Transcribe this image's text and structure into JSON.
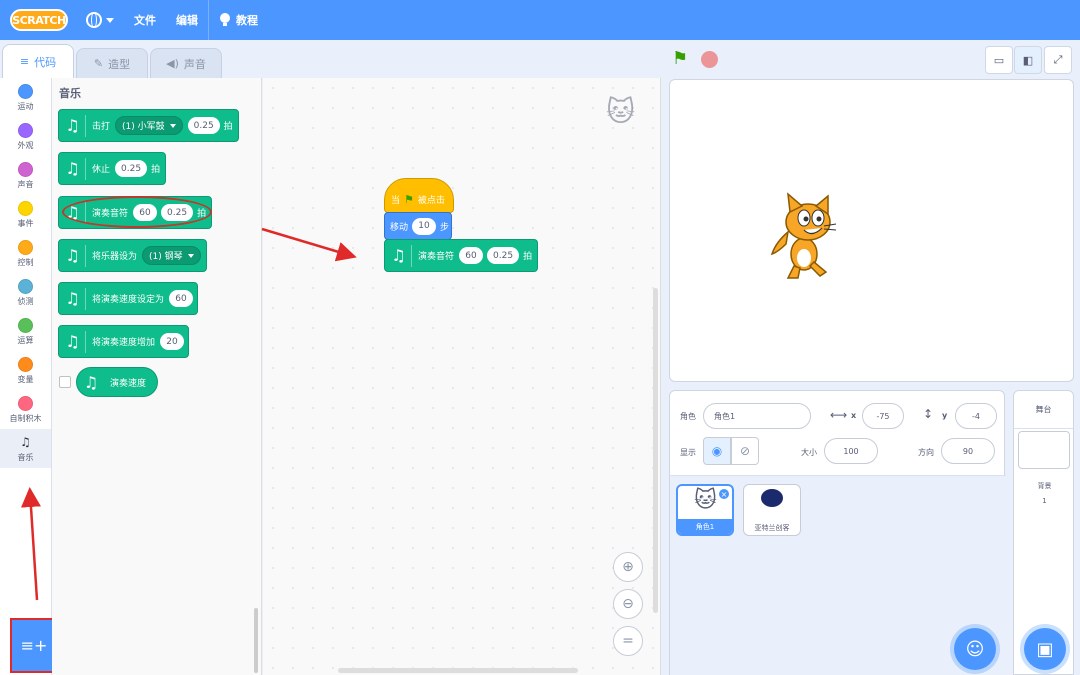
{
  "menubar": {
    "logo": "SCRATCH",
    "file": "文件",
    "edit": "编辑",
    "tutorials": "教程"
  },
  "tabs": [
    {
      "label": "代码",
      "icon": "code-icon",
      "active": true
    },
    {
      "label": "造型",
      "icon": "brush-icon",
      "active": false
    },
    {
      "label": "声音",
      "icon": "speaker-icon",
      "active": false
    }
  ],
  "categories": [
    {
      "label": "运动",
      "color": "#4c97ff"
    },
    {
      "label": "外观",
      "color": "#9966ff"
    },
    {
      "label": "声音",
      "color": "#cf63cf"
    },
    {
      "label": "事件",
      "color": "#ffd500"
    },
    {
      "label": "控制",
      "color": "#ffab19"
    },
    {
      "label": "侦测",
      "color": "#5cb1d6"
    },
    {
      "label": "运算",
      "color": "#59c059"
    },
    {
      "label": "变量",
      "color": "#ff8c1a"
    },
    {
      "label": "自制积木",
      "color": "#ff6680"
    },
    {
      "label": "音乐",
      "color": "#0fbd8c"
    }
  ],
  "palette": {
    "title": "音乐",
    "blocks": {
      "drum": {
        "text": "击打",
        "dropdown": "(1) 小军鼓",
        "beats": "0.25",
        "unit": "拍"
      },
      "rest": {
        "text": "休止",
        "beats": "0.25",
        "unit": "拍"
      },
      "note": {
        "text": "演奏音符",
        "note": "60",
        "beats": "0.25",
        "unit": "拍"
      },
      "instrument": {
        "text": "将乐器设为",
        "dropdown": "(1) 钢琴"
      },
      "tempo_set": {
        "text": "将演奏速度设定为",
        "value": "60"
      },
      "tempo_change": {
        "text": "将演奏速度增加",
        "value": "20"
      },
      "tempo_reporter": {
        "text": "演奏速度"
      }
    }
  },
  "script": {
    "hat": {
      "pre": "当",
      "post": "被点击"
    },
    "move": {
      "text": "移动",
      "value": "10",
      "unit": "步"
    },
    "note": {
      "text": "演奏音符",
      "note": "60",
      "beats": "0.25",
      "unit": "拍"
    }
  },
  "sprite_info": {
    "sprite_label": "角色",
    "sprite_name": "角色1",
    "x_label": "x",
    "x": "-75",
    "y_label": "y",
    "y": "-4",
    "show_label": "显示",
    "size_label": "大小",
    "size": "100",
    "direction_label": "方向",
    "direction": "90"
  },
  "sprites": [
    {
      "name": "角色1",
      "selected": true
    },
    {
      "name": "亚特兰创客",
      "selected": false
    }
  ],
  "stage_pane": {
    "title": "舞台",
    "backdrop_label": "背景",
    "backdrop_count": "1"
  }
}
